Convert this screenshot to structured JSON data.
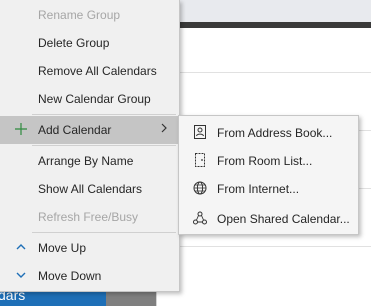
{
  "menu": {
    "items": [
      {
        "label": "Rename Group",
        "disabled": true
      },
      {
        "label": "Delete Group",
        "disabled": false
      },
      {
        "label": "Remove All Calendars",
        "disabled": false
      },
      {
        "label": "New Calendar Group",
        "disabled": false
      },
      {
        "label": "Add Calendar",
        "disabled": false,
        "icon": "plus-icon",
        "submenu": true
      },
      {
        "label": "Arrange By Name",
        "disabled": false
      },
      {
        "label": "Show All Calendars",
        "disabled": false
      },
      {
        "label": "Refresh Free/Busy",
        "disabled": true
      },
      {
        "label": "Move Up",
        "disabled": false,
        "icon": "chevron-up-icon"
      },
      {
        "label": "Move Down",
        "disabled": false,
        "icon": "chevron-down-icon"
      }
    ]
  },
  "submenu": {
    "items": [
      {
        "label": "From Address Book...",
        "icon": "address-book-icon"
      },
      {
        "label": "From Room List...",
        "icon": "room-list-icon"
      },
      {
        "label": "From Internet...",
        "icon": "globe-icon",
        "highlighted": true
      },
      {
        "label": "Open Shared Calendar...",
        "icon": "shared-calendar-icon"
      }
    ]
  },
  "background": {
    "folder_label": "dars"
  },
  "colors": {
    "accent": "#1e6fb7",
    "highlight": "#f7f41a",
    "menu_bg": "#f0f0f0",
    "hover_bg": "#c5c5c5",
    "disabled_text": "#a6a6a6"
  }
}
